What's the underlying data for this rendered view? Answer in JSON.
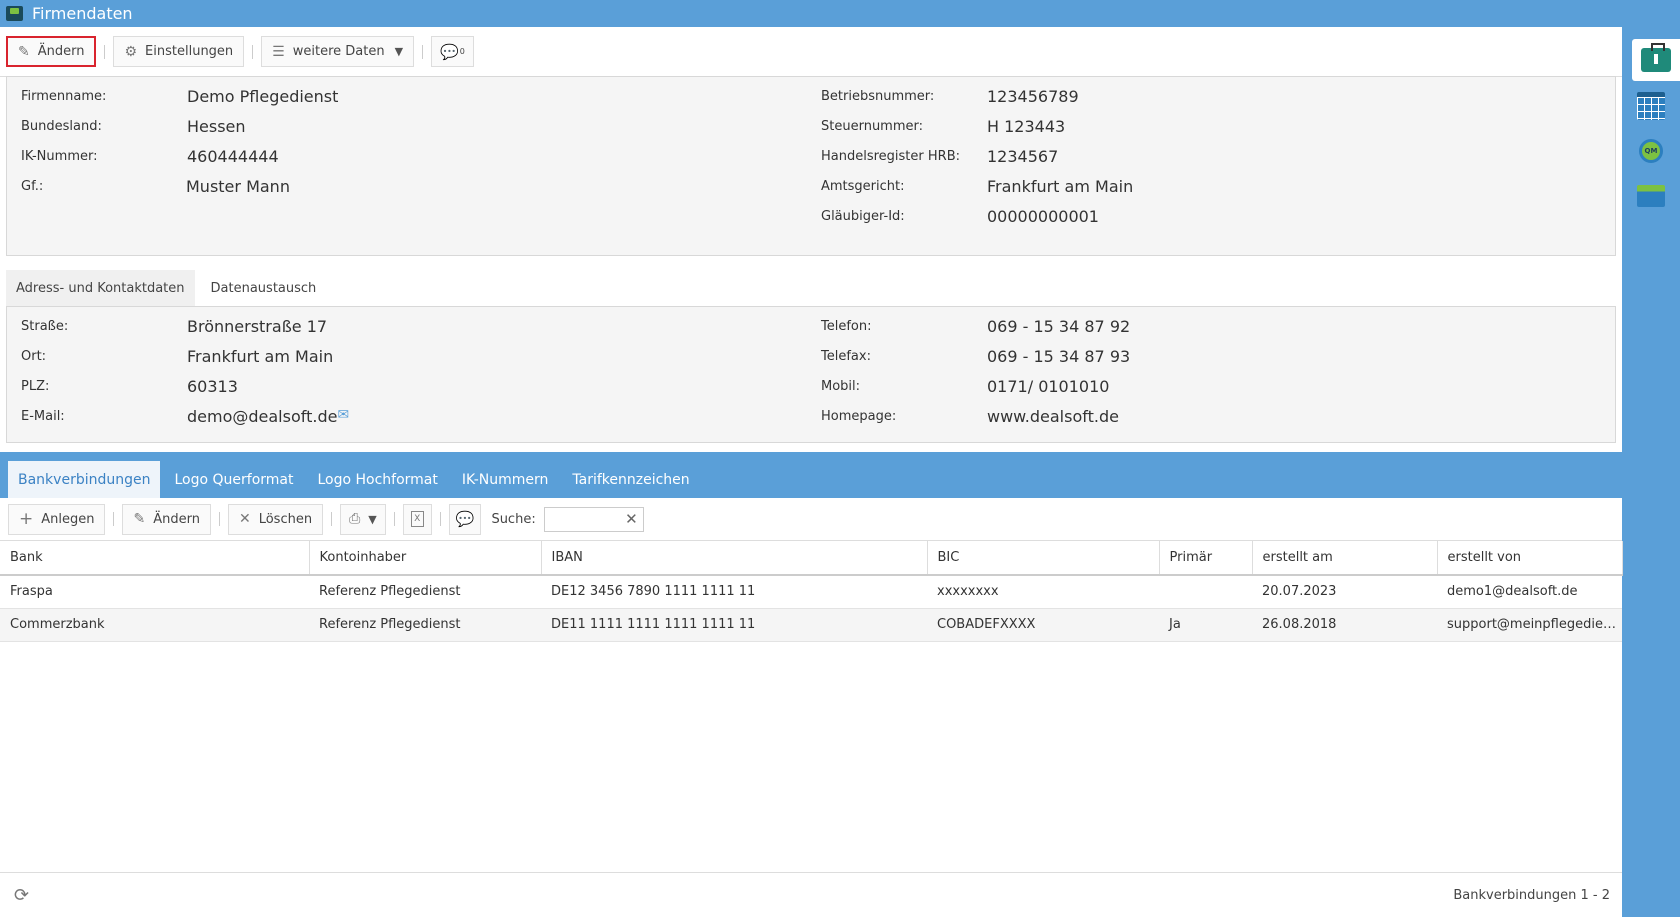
{
  "window": {
    "title": "Firmendaten"
  },
  "toolbar": {
    "edit_label": "Ändern",
    "settings_label": "Einstellungen",
    "more_label": "weitere Daten",
    "comments_count": "0"
  },
  "company": {
    "left": [
      {
        "label": "Firmenname:",
        "value": "Demo Pflegedienst"
      },
      {
        "label": "Bundesland:",
        "value": "Hessen"
      },
      {
        "label": "IK-Nummer:",
        "value": "460444444"
      },
      {
        "label": "Gf.:",
        "value": "Muster Mann"
      }
    ],
    "right": [
      {
        "label": "Betriebsnummer:",
        "value": "123456789"
      },
      {
        "label": "Steuernummer:",
        "value": "H 123443"
      },
      {
        "label": "Handelsregister HRB:",
        "value": "1234567"
      },
      {
        "label": "Amtsgericht:",
        "value": "Frankfurt am Main"
      },
      {
        "label": "Gläubiger-Id:",
        "value": "00000000001"
      }
    ]
  },
  "contact_tabs": [
    "Adress- und Kontaktdaten",
    "Datenaustausch"
  ],
  "contact": {
    "left": [
      {
        "label": "Straße:",
        "value": "Brönnerstraße 17"
      },
      {
        "label": "Ort:",
        "value": "Frankfurt am Main"
      },
      {
        "label": "PLZ:",
        "value": "60313"
      },
      {
        "label": "E-Mail:",
        "value": "demo@dealsoft.de"
      }
    ],
    "right": [
      {
        "label": "Telefon:",
        "value": "069 - 15 34 87 92"
      },
      {
        "label": "Telefax:",
        "value": "069 - 15 34 87 93"
      },
      {
        "label": "Mobil:",
        "value": "0171/ 0101010"
      },
      {
        "label": "Homepage:",
        "value": "www.dealsoft.de"
      }
    ]
  },
  "bottom_tabs": [
    "Bankverbindungen",
    "Logo Querformat",
    "Logo Hochformat",
    "IK-Nummern",
    "Tarifkennzeichen"
  ],
  "bank_toolbar": {
    "add_label": "Anlegen",
    "edit_label": "Ändern",
    "delete_label": "Löschen",
    "search_label": "Suche:",
    "search_value": ""
  },
  "bank_table": {
    "columns": [
      "Bank",
      "Kontoinhaber",
      "IBAN",
      "BIC",
      "Primär",
      "erstellt am",
      "erstellt von"
    ],
    "rows": [
      [
        "Fraspa",
        "Referenz Pflegedienst",
        "DE12 3456 7890 1111 1111 11",
        "xxxxxxxx",
        "",
        "20.07.2023",
        "demo1@dealsoft.de"
      ],
      [
        "Commerzbank",
        "Referenz Pflegedienst",
        "DE11 1111 1111 1111 1111 11",
        "COBADEFXXXX",
        "Ja",
        "26.08.2018",
        "support@meinpflegedienst.de"
      ]
    ]
  },
  "status": {
    "text": "Bankverbindungen 1 - 2"
  },
  "colors": {
    "accent": "#5a9fd8",
    "highlight": "#d9242e"
  }
}
